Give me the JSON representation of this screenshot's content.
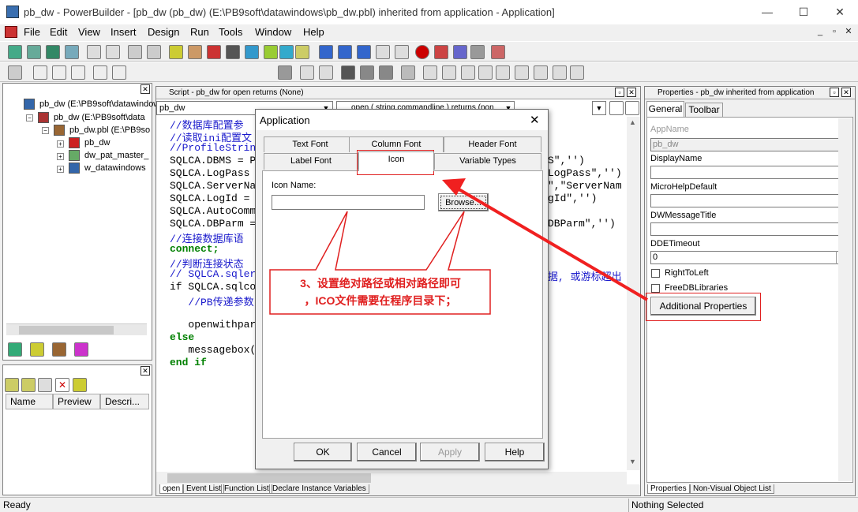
{
  "window": {
    "title": "pb_dw - PowerBuilder - [pb_dw (pb_dw) (E:\\PB9soft\\datawindows\\pb_dw.pbl) inherited from application - Application]",
    "minimize": "—",
    "maximize": "☐",
    "close": "✕"
  },
  "menu": {
    "items": [
      "File",
      "Edit",
      "View",
      "Insert",
      "Design",
      "Run",
      "Tools",
      "Window",
      "Help"
    ],
    "mdi_controls": [
      "_",
      "▫",
      "✕"
    ]
  },
  "library_tree": {
    "items": [
      {
        "label": "pb_dw (E:\\PB9soft\\datawindows"
      },
      {
        "label": "pb_dw (E:\\PB9soft\\data"
      },
      {
        "label": "pb_dw.pbl (E:\\PB9so"
      },
      {
        "label": "pb_dw"
      },
      {
        "label": "dw_pat_master_"
      },
      {
        "label": "w_datawindows"
      }
    ]
  },
  "list_view": {
    "columns": [
      "Name",
      "Preview",
      "Descri..."
    ]
  },
  "script": {
    "title": "Script - pb_dw for open returns (None)",
    "object_select": "pb_dw",
    "event_select": "open ( string commandline ) returns (non",
    "lines": [
      {
        "text": "//数据库配置参",
        "cls": "c-comment"
      },
      {
        "text": "//读取ini配置文",
        "cls": "c-comment"
      },
      {
        "text": "//ProfileStrin",
        "cls": "c-comment"
      },
      {
        "text": "SQLCA.DBMS = P",
        "cls": "c-plain"
      },
      {
        "text": "SQLCA.LogPass ",
        "cls": "c-plain"
      },
      {
        "text": "SQLCA.ServerNa",
        "cls": "c-plain"
      },
      {
        "text": "SQLCA.LogId = ",
        "cls": "c-plain"
      },
      {
        "text": "SQLCA.AutoComm",
        "cls": "c-plain"
      },
      {
        "text": "SQLCA.DBParm = ",
        "cls": "c-plain"
      },
      {
        "text": "//连接数据库语",
        "cls": "c-comment"
      },
      {
        "text": "connect;",
        "cls": "c-kw"
      },
      {
        "text": "//判断连接状态",
        "cls": "c-comment"
      },
      {
        "text": "// SQLCA.sqler",
        "cls": "c-comment"
      },
      {
        "text": "if SQLCA.sqlco",
        "cls": "c-plain"
      },
      {
        "text": "   //PB传递参数",
        "cls": "c-comment"
      },
      {
        "text": "",
        "cls": "c-plain"
      },
      {
        "text": "   openwithpar",
        "cls": "c-plain"
      },
      {
        "text": "else",
        "cls": "c-kw"
      },
      {
        "text": "   messagebox(",
        "cls": "c-plain"
      },
      {
        "text": "end if",
        "cls": "c-kw"
      }
    ],
    "right_fragments": [
      {
        "text": "S\",'')",
        "line": 3
      },
      {
        "text": "LogPass\",'')",
        "line": 4
      },
      {
        "text": "\",\"ServerNam",
        "line": 5
      },
      {
        "text": "gId\",'')",
        "line": 6
      },
      {
        "text": "DBParm\",'')",
        "line": 8
      },
      {
        "text": "据, 或游标超出",
        "line": 12
      }
    ],
    "bottom_tabs": [
      "open",
      "Event List",
      "Function List",
      "Declare Instance Variables"
    ]
  },
  "dialog": {
    "title": "Application",
    "tabs_row1": [
      "Text Font",
      "Column Font",
      "Header Font"
    ],
    "tabs_row2": [
      "Label Font",
      "Icon",
      "Variable Types"
    ],
    "icon_name_label": "Icon Name:",
    "icon_name_value": "",
    "browse_label": "Browse...",
    "ok_label": "OK",
    "cancel_label": "Cancel",
    "apply_label": "Apply",
    "help_label": "Help"
  },
  "annotation": {
    "line1": "3、设置绝对路径或相对路径即可",
    "line2": "，ICO文件需要在程序目录下；",
    "color": "#e02020"
  },
  "properties": {
    "title": "Properties - pb_dw inherited from application",
    "tabs": [
      "General",
      "Toolbar"
    ],
    "appname_label": "AppName",
    "appname_value": "pb_dw",
    "displayname_label": "DisplayName",
    "microhelp_label": "MicroHelpDefault",
    "dwmessage_label": "DWMessageTitle",
    "ddetimeout_label": "DDETimeout",
    "ddetimeout_value": "0",
    "righttoleft_label": "RightToLeft",
    "freedb_label": "FreeDBLibraries",
    "additional_label": "Additional Properties",
    "bottom_tabs": [
      "Properties",
      "Non-Visual Object List"
    ]
  },
  "status": {
    "left": "Ready",
    "right": "Nothing Selected"
  }
}
